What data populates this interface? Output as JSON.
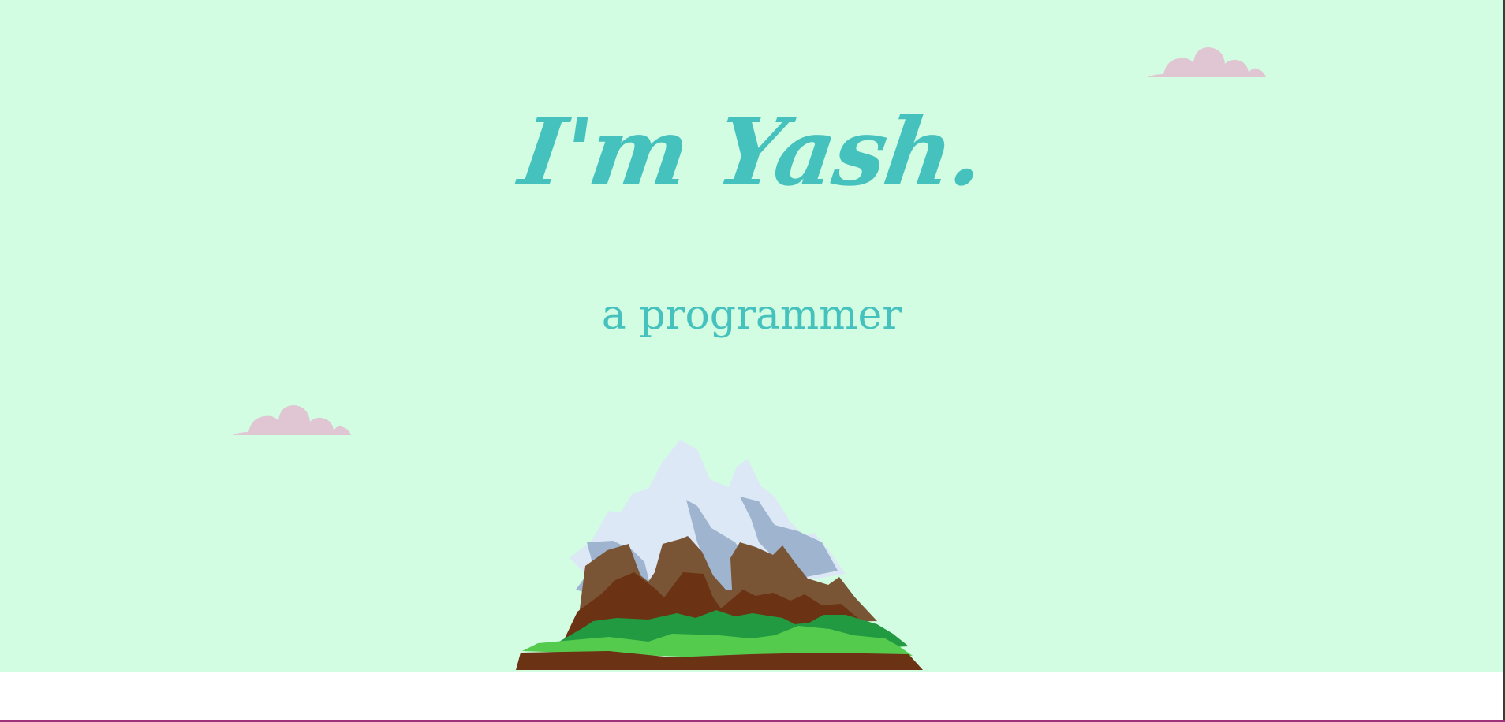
{
  "hero": {
    "headline": "I'm Yash.",
    "subtitle": "a programmer"
  },
  "colors": {
    "background": "#d2fde2",
    "accent_text": "#45c2bd",
    "cloud": "#e0c5d3",
    "snow": "#dde8f6",
    "snow_shadow": "#9eb4cf",
    "rock_light": "#7a5535",
    "rock_dark": "#6b3314",
    "grass_dark": "#229a42",
    "grass_light": "#55cb4e"
  },
  "icons": {
    "cloud_top": "cloud-icon",
    "cloud_left": "cloud-icon",
    "mountain": "mountain-illustration"
  }
}
